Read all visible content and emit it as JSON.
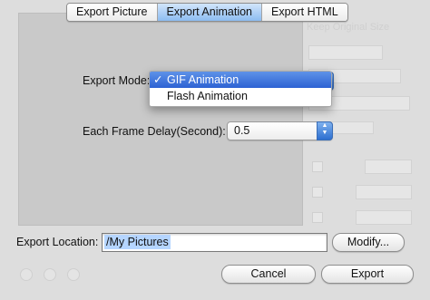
{
  "tabs": [
    {
      "label": "Export Picture",
      "active": false
    },
    {
      "label": "Export Animation",
      "active": true
    },
    {
      "label": "Export HTML",
      "active": false
    }
  ],
  "export_mode": {
    "label": "Export Mode:",
    "menu_items": [
      {
        "label": "GIF Animation",
        "checked": true,
        "check": "✓"
      },
      {
        "label": "Flash Animation",
        "checked": false,
        "check": ""
      }
    ]
  },
  "frame_delay": {
    "label": "Each Frame Delay(Second):",
    "value": "0.5"
  },
  "export_location": {
    "label": "Export Location:",
    "value": "/My Pictures"
  },
  "buttons": {
    "modify": "Modify...",
    "cancel": "Cancel",
    "export": "Export"
  },
  "background_ghost": {
    "top_option": "Keep Original Size"
  },
  "colors": {
    "accent": "#2d62d3",
    "tab_active": "#8cbcf1",
    "selection": "#b5d5ff"
  }
}
